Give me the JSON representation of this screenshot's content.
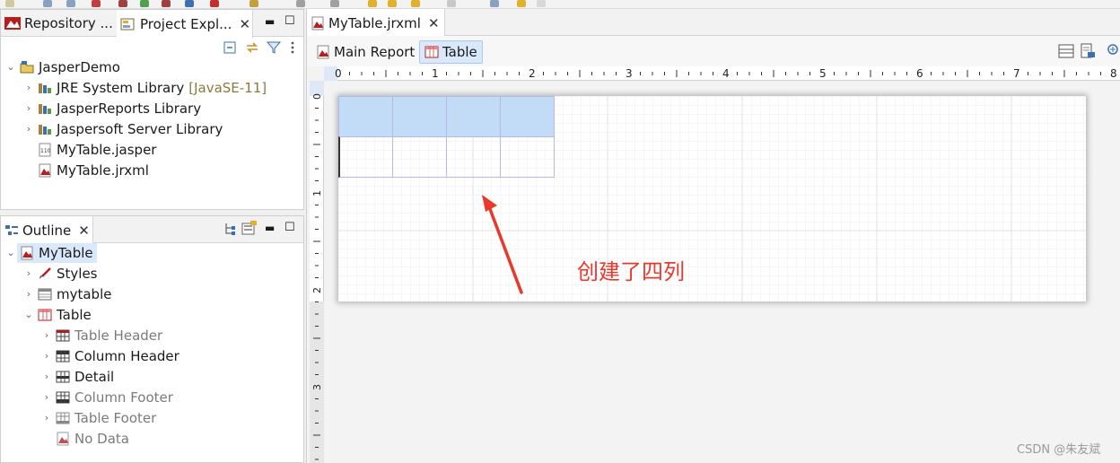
{
  "left_top_panel": {
    "tabs": [
      {
        "label": "Repository ...",
        "active": false
      },
      {
        "label": "Project Expl...",
        "active": true
      }
    ],
    "tree": [
      {
        "label": "JasperDemo",
        "level": 0,
        "expanded": true,
        "icon": "project-icon"
      },
      {
        "label": "JRE System Library",
        "suffix": "[JavaSE-11]",
        "level": 1,
        "expanded": false,
        "icon": "library-icon"
      },
      {
        "label": "JasperReports Library",
        "level": 1,
        "expanded": false,
        "icon": "library-icon"
      },
      {
        "label": "Jaspersoft Server Library",
        "level": 1,
        "expanded": false,
        "icon": "library-icon"
      },
      {
        "label": "MyTable.jasper",
        "level": 1,
        "icon": "jasper-file-icon"
      },
      {
        "label": "MyTable.jrxml",
        "level": 1,
        "icon": "jrxml-file-icon"
      }
    ]
  },
  "outline_panel": {
    "title": "Outline",
    "tree": [
      {
        "label": "MyTable",
        "level": 0,
        "expanded": true,
        "selected": true,
        "icon": "report-icon"
      },
      {
        "label": "Styles",
        "level": 1,
        "expanded": false,
        "icon": "styles-icon"
      },
      {
        "label": "mytable",
        "level": 1,
        "expanded": false,
        "icon": "dataset-icon"
      },
      {
        "label": "Table",
        "level": 1,
        "expanded": true,
        "icon": "table-icon"
      },
      {
        "label": "Table Header",
        "level": 2,
        "expanded": false,
        "dim": true,
        "icon": "table-section-icon"
      },
      {
        "label": "Column Header",
        "level": 2,
        "expanded": false,
        "dim": false,
        "icon": "table-section-icon"
      },
      {
        "label": "Detail",
        "level": 2,
        "expanded": false,
        "dim": false,
        "icon": "table-section-icon"
      },
      {
        "label": "Column Footer",
        "level": 2,
        "expanded": false,
        "dim": true,
        "icon": "table-section-icon"
      },
      {
        "label": "Table Footer",
        "level": 2,
        "expanded": false,
        "dim": true,
        "icon": "table-section-icon"
      },
      {
        "label": "No Data",
        "level": 2,
        "dim": true,
        "icon": "report-icon"
      }
    ]
  },
  "editor": {
    "file_tab": "MyTable.jrxml",
    "sub_tabs": [
      {
        "label": "Main Report",
        "active": false
      },
      {
        "label": "Table",
        "active": true
      }
    ],
    "ruler_h_labels": [
      "0",
      "1",
      "2",
      "3",
      "4",
      "5",
      "6",
      "7",
      "8"
    ],
    "ruler_v_labels": [
      "0",
      "1",
      "2",
      "3"
    ],
    "table_columns": 4,
    "annotation": "创建了四列"
  },
  "watermark": "CSDN @朱友斌",
  "colors": {
    "header_cell": "#c2dcf8",
    "annotation_red": "#e8392c",
    "selection": "#d9e8fb"
  }
}
